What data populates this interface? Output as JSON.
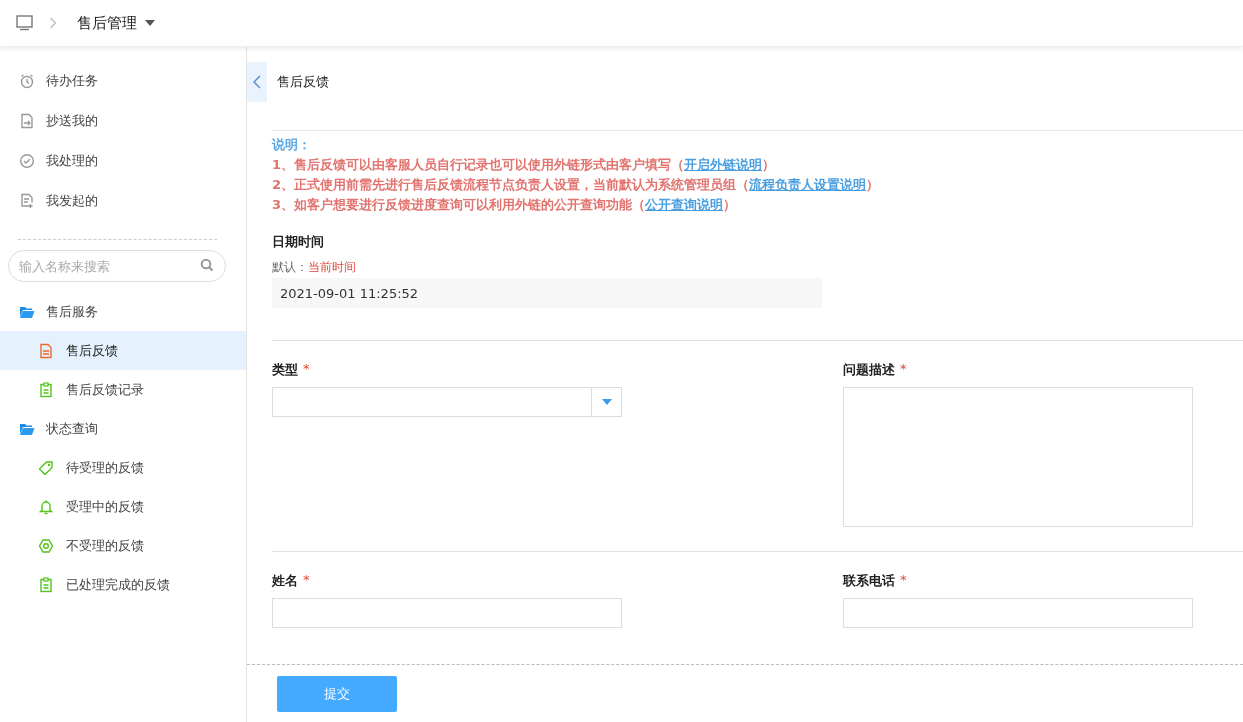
{
  "breadcrumb": {
    "title": "售后管理"
  },
  "sidebar": {
    "tasks": [
      {
        "label": "待办任务",
        "kind": "clock"
      },
      {
        "label": "抄送我的",
        "kind": "inbox"
      },
      {
        "label": "我处理的",
        "kind": "check"
      },
      {
        "label": "我发起的",
        "kind": "doc-plus"
      }
    ],
    "search": {
      "placeholder": "输入名称来搜索"
    },
    "tree": [
      {
        "label": "售后服务",
        "expanded": true,
        "children": [
          {
            "label": "售后反馈",
            "kind": "doc",
            "selected": true
          },
          {
            "label": "售后反馈记录",
            "kind": "clipboard",
            "selected": false
          }
        ]
      },
      {
        "label": "状态查询",
        "expanded": true,
        "children": [
          {
            "label": "待受理的反馈",
            "kind": "tag",
            "selected": false
          },
          {
            "label": "受理中的反馈",
            "kind": "bell",
            "selected": false
          },
          {
            "label": "不受理的反馈",
            "kind": "ring",
            "selected": false
          },
          {
            "label": "已处理完成的反馈",
            "kind": "clipboard",
            "selected": false
          }
        ]
      }
    ]
  },
  "page": {
    "title": "售后反馈"
  },
  "notice": {
    "heading": "说明：",
    "lines": [
      {
        "text": "1、售后反馈可以由客服人员自行记录也可以使用外链形式由客户填写（",
        "link": "开启外链说明",
        "tail": "）"
      },
      {
        "text": "2、正式使用前需先进行售后反馈流程节点负责人设置，当前默认为系统管理员组（",
        "link": "流程负责人设置说明",
        "tail": "）"
      },
      {
        "text": "3、如客户想要进行反馈进度查询可以利用外链的公开查询功能（",
        "link": "公开查询说明",
        "tail": "）"
      }
    ]
  },
  "date_field": {
    "label": "日期时间",
    "hint_label": "默认：",
    "hint_value": "当前时间",
    "value": "2021-09-01 11:25:52"
  },
  "rows": [
    [
      {
        "label": "类型",
        "required_mark": "*",
        "kind": "select"
      },
      {
        "label": "问题描述",
        "required_mark": "*",
        "kind": "textarea"
      }
    ],
    [
      {
        "label": "姓名",
        "required_mark": "*",
        "kind": "text"
      },
      {
        "label": "联系电话",
        "required_mark": "*",
        "kind": "text"
      }
    ]
  ],
  "submit": {
    "label": "提交"
  }
}
